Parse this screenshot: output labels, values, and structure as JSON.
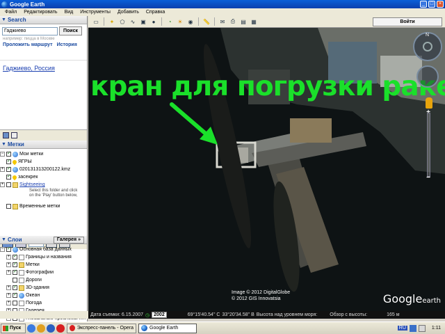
{
  "window": {
    "title": "Google Earth",
    "controls": [
      "_",
      "□",
      "×"
    ]
  },
  "menu": [
    "Файл",
    "Редактировать",
    "Вид",
    "Инструменты",
    "Добавить",
    "Справка"
  ],
  "search": {
    "header": "Search",
    "input_value": "Гаджиево",
    "button": "Поиск",
    "hint": "например: пицца в Москве",
    "link_route": "Проложить маршрут",
    "link_history": "История",
    "result": "Гаджиево, Россия"
  },
  "places": {
    "header": "Метки",
    "my_places": "Мои метки",
    "items": [
      "ЯГРЫ",
      "020131313200122.kmz",
      "засекрек"
    ],
    "sightseeing_label": "Sightseeing",
    "sightseeing_desc_1": "Select this folder and click",
    "sightseeing_desc_2": "on the 'Play' button below,",
    "temp": "Временные метки"
  },
  "layers": {
    "header": "Слои",
    "gallery_button": "Галерея",
    "gallery_arrows": "»",
    "items": [
      "Основная база данных",
      "Границы и названия",
      "Метки",
      "Фотографии",
      "Дороги",
      "3D-здания",
      "Океан",
      "Погода",
      "Галерея",
      "Глобальные проблемы н..."
    ]
  },
  "toolbar": {
    "login_button": "Войти"
  },
  "map": {
    "caption": "кран для погрузки ракет",
    "copyright_line1": "Image © 2012 DigitalGlobe",
    "copyright_line2": "© 2012 GIS Innovatsia",
    "logo_google": "Google",
    "logo_earth": "earth",
    "compass_n": "N",
    "zoom_plus": "+",
    "zoom_minus": "−"
  },
  "status": {
    "date_label": "Дата съемки: 6.15.2007",
    "year": "2002",
    "lat": "69°15'40.54\" С",
    "lon": "33°20'34.58\" В",
    "altitude": "Высота над уровнем моря:",
    "eye": "Обзор с высоты:",
    "eye_value": "165 м"
  },
  "taskbar": {
    "start": "Пуск",
    "task_opera": "Экспресс-панель - Opera",
    "task_ge": "Google Earth",
    "lang": "RU",
    "clock": "1:11"
  },
  "colors": {
    "caption_green": "#1ae02a",
    "title_blue": "#0a5fd8"
  }
}
